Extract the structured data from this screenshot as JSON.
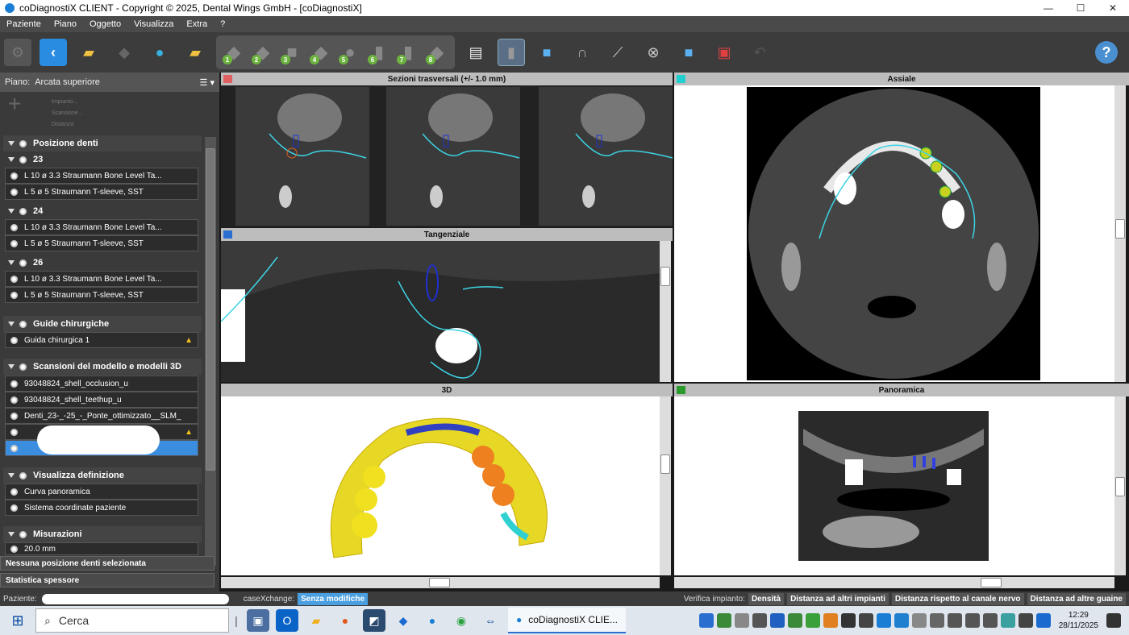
{
  "window": {
    "title": "coDiagnostiX CLIENT - Copyright © 2025, Dental Wings GmbH - [coDiagnostiX]",
    "min": "—",
    "max": "☐",
    "close": "✕"
  },
  "menu": [
    "Paziente",
    "Piano",
    "Oggetto",
    "Visualizza",
    "Extra",
    "?"
  ],
  "toolbar": {
    "steps": [
      "1",
      "2",
      "3",
      "4",
      "5",
      "6",
      "7",
      "8"
    ]
  },
  "sidebar": {
    "plan_label": "Piano:",
    "plan_name": "Arcata superiore",
    "ghost_labels": [
      "Impianto...",
      "Scansione...",
      "Distanza"
    ],
    "teeth_title": "Posizione denti",
    "teeth": [
      {
        "num": "23",
        "imp": "L 10  ø 3.3   Straumann Bone Level Ta...",
        "sleeve": "L 5  ø 5   Straumann T-sleeve, SST"
      },
      {
        "num": "24",
        "imp": "L 10  ø 3.3   Straumann Bone Level Ta...",
        "sleeve": "L 5  ø 5   Straumann T-sleeve, SST"
      },
      {
        "num": "26",
        "imp": "L 10  ø 3.3   Straumann Bone Level Ta...",
        "sleeve": "L 5  ø 5   Straumann T-sleeve, SST"
      }
    ],
    "guides_title": "Guide chirurgiche",
    "guide": "Guida chirurgica 1",
    "scans_title": "Scansioni del modello e modelli 3D",
    "scans": [
      "93048824_shell_occlusion_u",
      "93048824_shell_teethup_u",
      "Denti_23-_-25_-_Ponte_ottimizzato__SLM_"
    ],
    "def_title": "Visualizza definizione",
    "defs": [
      "Curva panoramica",
      "Sistema coordinate paziente"
    ],
    "meas_title": "Misurazioni",
    "meas": "20.0 mm",
    "nosel": "Nessuna posizione denti selezionata",
    "stats": "Statistica spessore"
  },
  "views": {
    "cross": "Sezioni trasversali (+/- 1.0 mm)",
    "axial": "Assiale",
    "tangential": "Tangenziale",
    "three_d": "3D",
    "pano": "Panoramica"
  },
  "status": {
    "patient_label": "Paziente:",
    "casex_label": "caseXchange:",
    "casex_value": "Senza modifiche",
    "verify_label": "Verifica impianto:",
    "b1": "Densità",
    "b2": "Distanza ad altri impianti",
    "b3": "Distanza rispetto al canale nervo",
    "b4": "Distanza ad altre guaine"
  },
  "taskbar": {
    "search": "Cerca",
    "active_app": "coDiagnostiX CLIE...",
    "time": "12:29",
    "date": "28/11/2025"
  },
  "colors": {
    "cross": "#e06060",
    "axial": "#20d0d0",
    "tangential": "#2a6fd0",
    "pano": "#2a9a2a",
    "accent": "#3b8de0"
  }
}
